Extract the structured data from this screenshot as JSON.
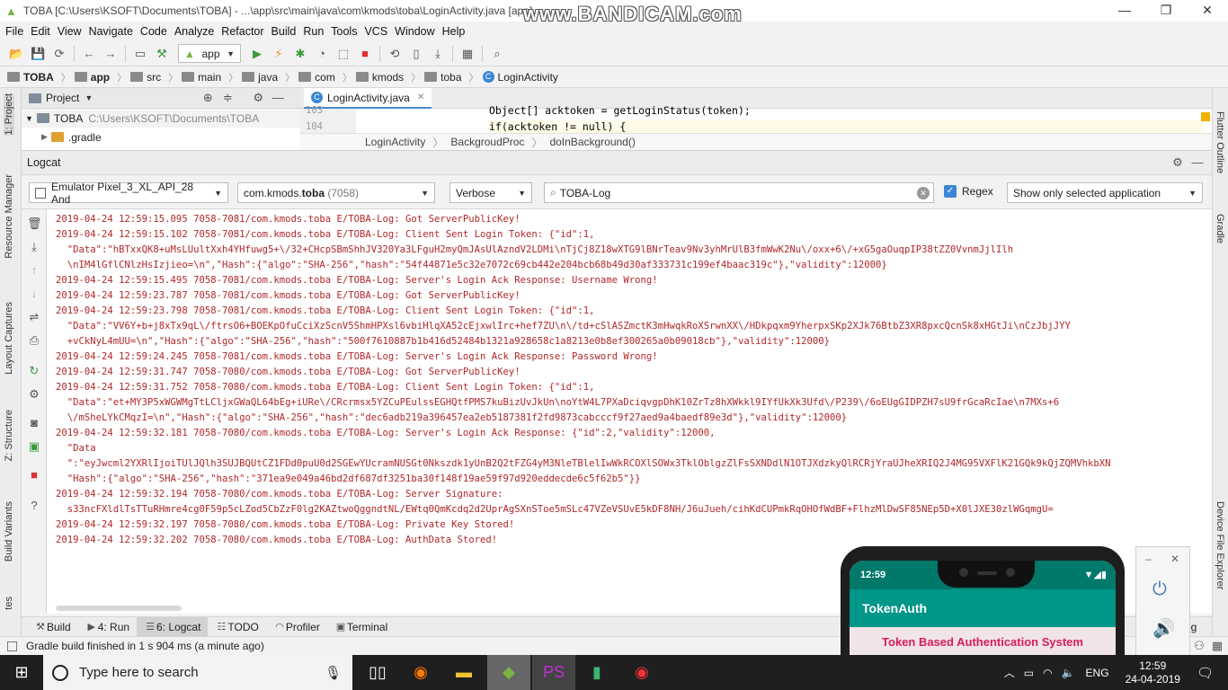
{
  "window": {
    "title": "TOBA [C:\\Users\\KSOFT\\Documents\\TOBA] - ...\\app\\src\\main\\java\\com\\kmods\\toba\\LoginActivity.java [app]",
    "watermark": "www.BANDICAM.com"
  },
  "menu": [
    "File",
    "Edit",
    "View",
    "Navigate",
    "Code",
    "Analyze",
    "Refactor",
    "Build",
    "Run",
    "Tools",
    "VCS",
    "Window",
    "Help"
  ],
  "toolbar": {
    "run_config": "app"
  },
  "breadcrumb": [
    "TOBA",
    "app",
    "src",
    "main",
    "java",
    "com",
    "kmods",
    "toba",
    "LoginActivity"
  ],
  "left_tabs": [
    "1: Project",
    "Resource Manager",
    "Layout Captures",
    "Z: Structure",
    "Build Variants",
    "tes"
  ],
  "right_tabs": [
    "Flutter Outline",
    "Gradle",
    "Device File Explorer"
  ],
  "project": {
    "header": "Project",
    "root_name": "TOBA",
    "root_path": "C:\\Users\\KSOFT\\Documents\\TOBA",
    "child": ".gradle"
  },
  "editor": {
    "tab": "LoginActivity.java",
    "lines": [
      {
        "num": "103",
        "code": "Object[] acktoken = getLoginStatus(token);"
      },
      {
        "num": "104",
        "code": "if(acktoken != null) {"
      }
    ],
    "crumbs": [
      "LoginActivity",
      "BackgroudProc",
      "doInBackground()"
    ]
  },
  "logcat": {
    "title": "Logcat",
    "device": "Emulator Pixel_3_XL_API_28 And",
    "process_name": "com.kmods.",
    "process_bold": "toba",
    "process_pid": " (7058)",
    "level": "Verbose",
    "search": "TOBA-Log",
    "regex_label": "Regex",
    "filter": "Show only selected application",
    "lines": [
      "2019-04-24 12:59:15.095 7058-7081/com.kmods.toba E/TOBA-Log: Got ServerPublicKey!",
      "2019-04-24 12:59:15.102 7058-7081/com.kmods.toba E/TOBA-Log: Client Sent Login Token: {\"id\":1,",
      "  \"Data\":\"hBTxxQK8+uMsLUultXxh4YHfuwg5+\\/32+CHcpSBmShhJV320Ya3LFguH2myQmJAsUlAzndV2LDMi\\nTjCj8Z18wXTG9lBNrTeav9Nv3yhMrUlB3fmWwK2Nu\\/oxx+6\\/+xG5gaOuqpIP38tZZ0VvnmJjlIlh",
      "  \\nIM4lGflCNlzHsIzjieo=\\n\",\"Hash\":{\"algo\":\"SHA-256\",\"hash\":\"54f44871e5c32e7072c69cb442e204bcb68b49d30af333731c199ef4baac319c\"},\"validity\":12000}",
      "2019-04-24 12:59:15.495 7058-7081/com.kmods.toba E/TOBA-Log: Server's Login Ack Response: Username Wrong!",
      "2019-04-24 12:59:23.787 7058-7081/com.kmods.toba E/TOBA-Log: Got ServerPublicKey!",
      "2019-04-24 12:59:23.798 7058-7081/com.kmods.toba E/TOBA-Log: Client Sent Login Token: {\"id\":1,",
      "  \"Data\":\"VV6Y+b+j8xTx9qL\\/ftrsO6+BOEKpOfuCciXzScnV5ShmHPXsl6vbiHlqXA52cEjxwlIrc+hef7ZU\\n\\/td+cSlASZmctK3mHwqkRoXSrwnXX\\/HDkpqxm9YherpxSKp2XJk76BtbZ3XR8pxcQcnSk8xHGtJi\\nCzJbjJYY",
      "  +vCkNyL4mUU=\\n\",\"Hash\":{\"algo\":\"SHA-256\",\"hash\":\"500f7610887b1b416d52484b1321a928658c1a8213e0b8ef300265a0b09018cb\"},\"validity\":12000}",
      "2019-04-24 12:59:24.245 7058-7081/com.kmods.toba E/TOBA-Log: Server's Login Ack Response: Password Wrong!",
      "2019-04-24 12:59:31.747 7058-7080/com.kmods.toba E/TOBA-Log: Got ServerPublicKey!",
      "2019-04-24 12:59:31.752 7058-7080/com.kmods.toba E/TOBA-Log: Client Sent Login Token: {\"id\":1,",
      "  \"Data\":\"et+MY3P5xWGWMgTtLCljxGWaQL64bEg+iURe\\/CRcrmsx5YZCuPEulssEGHQtfPMS7kuBizUvJkUn\\noYtW4L7PXaDciqvgpDhK10ZrTz8hXWkkl9IYfUkXk3Ufd\\/P239\\/6oEUgGIDPZH7sU9frGcaRcIae\\n7MXs+6",
      "  \\/mSheLYkCMqzI=\\n\",\"Hash\":{\"algo\":\"SHA-256\",\"hash\":\"dec6adb219a396457ea2eb5187381f2fd9873cabcccf9f27aed9a4baedf89e3d\"},\"validity\":12000}",
      "2019-04-24 12:59:32.181 7058-7080/com.kmods.toba E/TOBA-Log: Server's Login Ack Response: {\"id\":2,\"validity\":12000,",
      "  \"Data",
      "  \":\"eyJwcml2YXRlIjoiTUlJQlh3SUJBQUtCZ1FDd0puU0d2SGEwYUcramNUSGt0Nkszdk1yUnB2Q2tFZG4yM3NleTBlelIwWkRCOXlSOWx3TklOblgzZlFsSXNDdlN1OTJXdzkyQlRCRjYraUJheXRIQ2J4MG95VXFlK21GQk9kQjZQMVhkbXN",
      "  \"Hash\":{\"algo\":\"SHA-256\",\"hash\":\"371ea9e049a46bd2df687df3251ba30f148f19ae59f97d920eddecde6c5f62b5\"}}",
      "2019-04-24 12:59:32.194 7058-7080/com.kmods.toba E/TOBA-Log: Server Signature:",
      "  s33ncFXldlTsTTuRHmre4cg0F59p5cLZod5CbZzF0lg2KAZtwoQggndtNL/EWtq0QmKcdq2d2UprAgSXnSToe5mSLc47VZeVSUvE5kDF8NH/J6uJueh/cihKdCUPmkRqOHOfWdBF+FlhzMlDwSF85NEp5D+X0lJXE30zlWGqmgU=",
      "2019-04-24 12:59:32.197 7058-7080/com.kmods.toba E/TOBA-Log: Private Key Stored!",
      "2019-04-24 12:59:32.202 7058-7080/com.kmods.toba E/TOBA-Log: AuthData Stored!"
    ]
  },
  "bottom_tabs": [
    {
      "label": "Build"
    },
    {
      "label": "4: Run"
    },
    {
      "label": "6: Logcat"
    },
    {
      "label": "TODO"
    },
    {
      "label": "Profiler"
    },
    {
      "label": "Terminal"
    }
  ],
  "event_log_partial": "og",
  "status": "Gradle build finished in 1 s 904 ms (a minute ago)",
  "emulator": {
    "time": "12:59",
    "app_title": "TokenAuth",
    "heading": "Token Based Authentication System"
  },
  "taskbar": {
    "search_placeholder": "Type here to search",
    "lang": "ENG",
    "time": "12:59",
    "date": "24-04-2019"
  }
}
